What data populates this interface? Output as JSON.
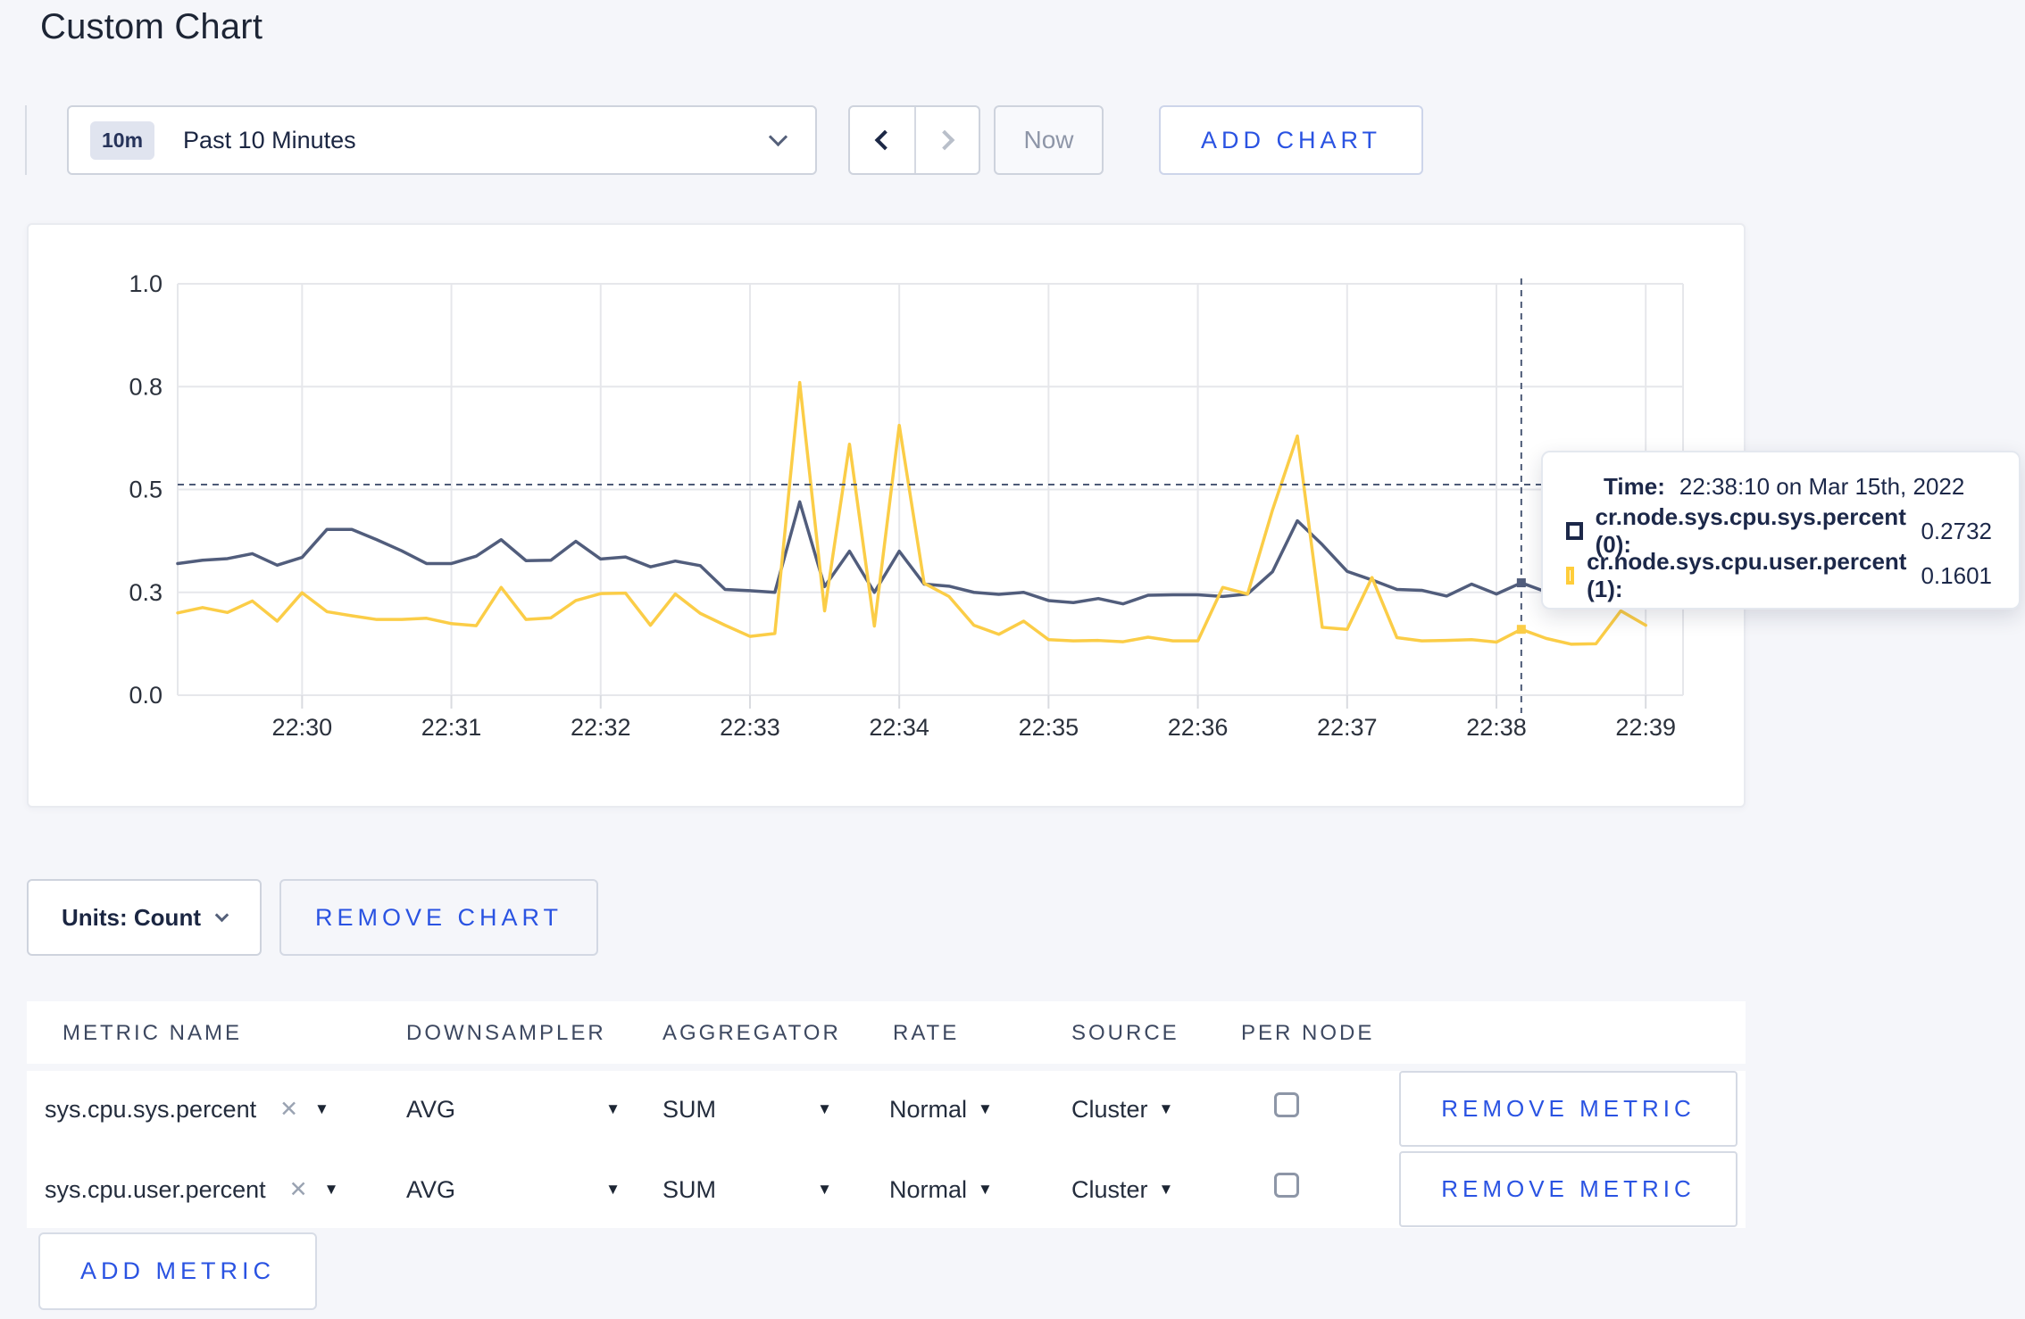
{
  "page": {
    "title": "Custom Chart"
  },
  "icons": {
    "caret_down": "▼",
    "close": "✕"
  },
  "toolbar": {
    "range_badge": "10m",
    "range_label": "Past 10 Minutes",
    "now_label": "Now",
    "add_chart_label": "ADD CHART"
  },
  "tooltip": {
    "time_label": "Time:",
    "time_value": "22:38:10 on Mar 15th, 2022",
    "rows": [
      {
        "label": "cr.node.sys.cpu.sys.percent (0):",
        "value": "0.2732",
        "color": "#1c2849"
      },
      {
        "label": "cr.node.sys.cpu.user.percent (1):",
        "value": "0.1601",
        "color": "#ffcd3a"
      }
    ]
  },
  "units_bar": {
    "units_label": "Units: Count",
    "remove_chart_label": "REMOVE CHART"
  },
  "metrics_table": {
    "columns": [
      "METRIC NAME",
      "DOWNSAMPLER",
      "AGGREGATOR",
      "RATE",
      "SOURCE",
      "PER NODE"
    ],
    "rows": [
      {
        "metric": "sys.cpu.sys.percent",
        "downsampler": "AVG",
        "aggregator": "SUM",
        "rate": "Normal",
        "source": "Cluster",
        "per_node_checked": false,
        "remove_label": "REMOVE METRIC"
      },
      {
        "metric": "sys.cpu.user.percent",
        "downsampler": "AVG",
        "aggregator": "SUM",
        "rate": "Normal",
        "source": "Cluster",
        "per_node_checked": false,
        "remove_label": "REMOVE METRIC"
      }
    ],
    "add_metric_label": "ADD METRIC"
  },
  "chart_data": {
    "type": "line",
    "title": "",
    "xlabel": "",
    "ylabel": "",
    "ylim": [
      0,
      1
    ],
    "grid": true,
    "start_time": "22:29:10",
    "sample_step_seconds": 10,
    "x_domain_seconds": [
      0,
      605
    ],
    "x_ticks": [
      {
        "s": 50,
        "label": "22:30"
      },
      {
        "s": 110,
        "label": "22:31"
      },
      {
        "s": 170,
        "label": "22:32"
      },
      {
        "s": 230,
        "label": "22:33"
      },
      {
        "s": 290,
        "label": "22:34"
      },
      {
        "s": 350,
        "label": "22:35"
      },
      {
        "s": 410,
        "label": "22:36"
      },
      {
        "s": 470,
        "label": "22:37"
      },
      {
        "s": 530,
        "label": "22:38"
      },
      {
        "s": 590,
        "label": "22:39"
      }
    ],
    "y_ticks": [
      {
        "v": 0,
        "label": "0.0"
      },
      {
        "v": 0.25,
        "label": "0.3"
      },
      {
        "v": 0.5,
        "label": "0.5"
      },
      {
        "v": 0.75,
        "label": "0.8"
      },
      {
        "v": 1,
        "label": "1.0"
      }
    ],
    "series": [
      {
        "name": "cr.node.sys.cpu.sys.percent",
        "color": "#515d7c",
        "values": [
          0.32,
          0.328,
          0.332,
          0.344,
          0.316,
          0.335,
          0.403,
          0.403,
          0.378,
          0.351,
          0.32,
          0.32,
          0.338,
          0.378,
          0.327,
          0.328,
          0.374,
          0.331,
          0.336,
          0.312,
          0.326,
          0.315,
          0.257,
          0.254,
          0.25,
          0.47,
          0.264,
          0.35,
          0.25,
          0.35,
          0.27,
          0.265,
          0.25,
          0.245,
          0.25,
          0.23,
          0.225,
          0.235,
          0.222,
          0.243,
          0.244,
          0.244,
          0.24,
          0.246,
          0.3,
          0.424,
          0.366,
          0.301,
          0.28,
          0.257,
          0.255,
          0.241,
          0.27,
          0.246,
          0.2732,
          0.251,
          0.248,
          0.255,
          0.262,
          0.268
        ]
      },
      {
        "name": "cr.node.sys.cpu.user.percent",
        "color": "#fbcd47",
        "values": [
          0.2,
          0.213,
          0.201,
          0.229,
          0.18,
          0.249,
          0.203,
          0.193,
          0.184,
          0.184,
          0.187,
          0.174,
          0.169,
          0.262,
          0.184,
          0.188,
          0.23,
          0.247,
          0.248,
          0.17,
          0.246,
          0.199,
          0.17,
          0.143,
          0.15,
          0.76,
          0.205,
          0.61,
          0.168,
          0.656,
          0.272,
          0.24,
          0.17,
          0.148,
          0.18,
          0.135,
          0.132,
          0.133,
          0.13,
          0.141,
          0.132,
          0.132,
          0.262,
          0.246,
          0.45,
          0.63,
          0.165,
          0.16,
          0.286,
          0.14,
          0.132,
          0.133,
          0.135,
          0.129,
          0.1601,
          0.138,
          0.124,
          0.125,
          0.205,
          0.17
        ]
      }
    ],
    "crosshair": {
      "s": 540,
      "h_value": 0.512,
      "color": "#4d5b77",
      "points": [
        {
          "series": 0,
          "value": 0.2732
        },
        {
          "series": 1,
          "value": 0.1601
        }
      ]
    },
    "gridline_color": "#e6e7eb",
    "axis_text_color": "#2b313c"
  }
}
